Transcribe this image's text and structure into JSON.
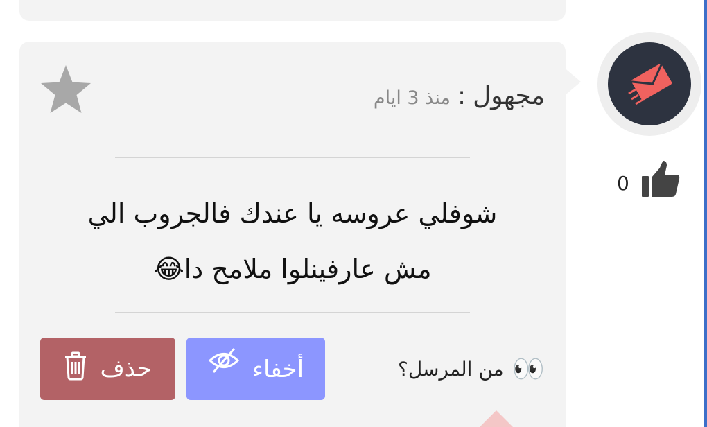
{
  "card": {
    "sender_name": "مجهول",
    "separator": ":",
    "time": "منذ 3 ايام",
    "message_line1": "شوفلي عروسه يا عندك فالجروب الي",
    "message_line2": "مش عارفينلوا ملامح دا😂",
    "likes": "0"
  },
  "actions": {
    "delete_label": "حذف",
    "hide_label": "أخفاء",
    "who_sent_label": "من المرسل؟",
    "eyes_emoji": "👀"
  },
  "colors": {
    "delete": "#b36266",
    "hide": "#8c96ff",
    "avatar_bg": "#2d3340",
    "avatar_icon": "#f0625f",
    "card_bg": "#f3f3f3"
  },
  "icons": {
    "favorite": "star-icon",
    "like": "thumbs-up-icon",
    "delete": "trash-icon",
    "hide": "eye-slash-icon",
    "avatar": "flying-envelope-icon"
  }
}
